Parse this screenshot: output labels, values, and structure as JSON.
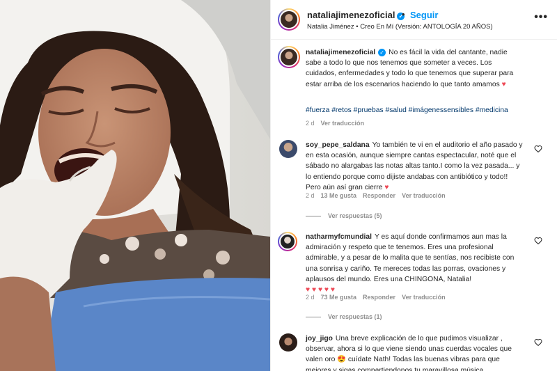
{
  "post": {
    "username": "nataliajimenezoficial",
    "follow_label": "Seguir",
    "separator": "•",
    "song": "Natalia Jiménez • Creo En Mí (Versión: ANTOLOGÍA 20 AÑOS)",
    "more_label": "•••",
    "verified_glyph": "✓"
  },
  "caption": {
    "username": "nataliajimenezoficial",
    "text": "No es fácil la vida del cantante, nadie sabe a todo lo que nos tenemos que someter a veces. Los cuidados, enfermedades y todo lo que tenemos que superar para estar arriba de los escenarios haciendo lo que tanto amamos",
    "emoji": "♥",
    "hashtags": "#fuerza #retos #pruebas #salud #imágenessensibles #medicina",
    "time": "2 d",
    "translate": "Ver traducción"
  },
  "comments": [
    {
      "username": "soy_pepe_saldana",
      "text": "Yo también te vi en el auditorio el año pasado y en esta ocasión, aunque siempre cantas espectacular, noté que el sábado no alargabas las notas altas tanto.I como la vez pasada... y lo entiendo porque como dijiste andabas con antibiótico y todo!! Pero aún así gran cierre",
      "emoji": "♥",
      "time": "2 d",
      "likes": "13 Me gusta",
      "reply": "Responder",
      "translate": "Ver traducción",
      "replies": "Ver respuestas (5)",
      "avatar_color": "#3b4a6b"
    },
    {
      "username": "natharmyfcmundial",
      "text": "Y es aquí donde confirmamos aun mas la admiración y respeto que te tenemos. Eres una profesional admirable, y a pesar de lo malita que te sentías, nos recibiste con una sonrisa y cariño. Te mereces todas las porras, ovaciones y aplausos del mundo. Eres una CHINGONA, Natalia!",
      "emoji": "♥ ♥ ♥ ♥ ♥",
      "time": "2 d",
      "likes": "73 Me gusta",
      "reply": "Responder",
      "translate": "Ver traducción",
      "replies": "Ver respuestas (1)"
    },
    {
      "username": "joy_jigo",
      "text": "Una breve explicación de lo que pudimos visualizar , observar, ahora si lo que viene siendo unas cuerdas vocales que valen oro 😍 cuídate Nath! Todas las buenas vibras para que mejores y sigas compartiendonos tu maravillosa música.",
      "avatar_color": "#2a1d18"
    }
  ],
  "colors": {
    "link": "#0095f6",
    "hashtag": "#00376b",
    "heart": "#ed4956",
    "muted": "#8e8e8e"
  },
  "icons": [
    "verified-badge-icon",
    "more-options-icon",
    "heart-outline-icon"
  ]
}
